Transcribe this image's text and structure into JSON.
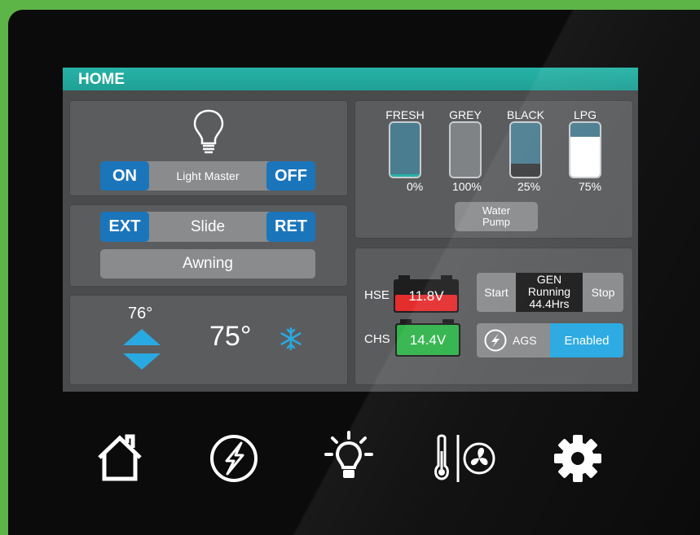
{
  "header": {
    "title": "HOME"
  },
  "lighting": {
    "on_label": "ON",
    "master_label": "Light Master",
    "off_label": "OFF"
  },
  "slide": {
    "ext_label": "EXT",
    "label": "Slide",
    "ret_label": "RET",
    "awning_label": "Awning"
  },
  "climate": {
    "setpoint": "76°",
    "current_temp": "75°",
    "mode_icon": "snowflake-icon"
  },
  "tanks": [
    {
      "name": "FRESH",
      "percent_label": "0%",
      "level": 0.05,
      "fill_color": "#27b3a6"
    },
    {
      "name": "GREY",
      "percent_label": "100%",
      "level": 1.0,
      "fill_color": "#808385"
    },
    {
      "name": "BLACK",
      "percent_label": "25%",
      "level": 0.25,
      "fill_color": "#3b3c3e"
    },
    {
      "name": "LPG",
      "percent_label": "75%",
      "level": 0.75,
      "fill_color": "#ffffff"
    }
  ],
  "water_pump": {
    "label_line1": "Water",
    "label_line2": "Pump"
  },
  "batteries": {
    "hse_label": "HSE",
    "hse_voltage": "11.8V",
    "hse_color": "#e52d2d",
    "chs_label": "CHS",
    "chs_voltage": "14.4V",
    "chs_color": "#2fb34a"
  },
  "generator": {
    "start_label": "Start",
    "status_line1": "GEN",
    "status_line2": "Running",
    "status_line3": "44.4Hrs",
    "stop_label": "Stop"
  },
  "ags": {
    "label": "AGS",
    "status": "Enabled",
    "status_color": "#29a9e1"
  },
  "nav": [
    "home-icon",
    "power-icon",
    "light-icon",
    "climate-fan-icon",
    "settings-icon"
  ],
  "colors": {
    "accent": "#27b3a6",
    "button_blue": "#1b75bb",
    "arrow_blue": "#29a9e1"
  }
}
